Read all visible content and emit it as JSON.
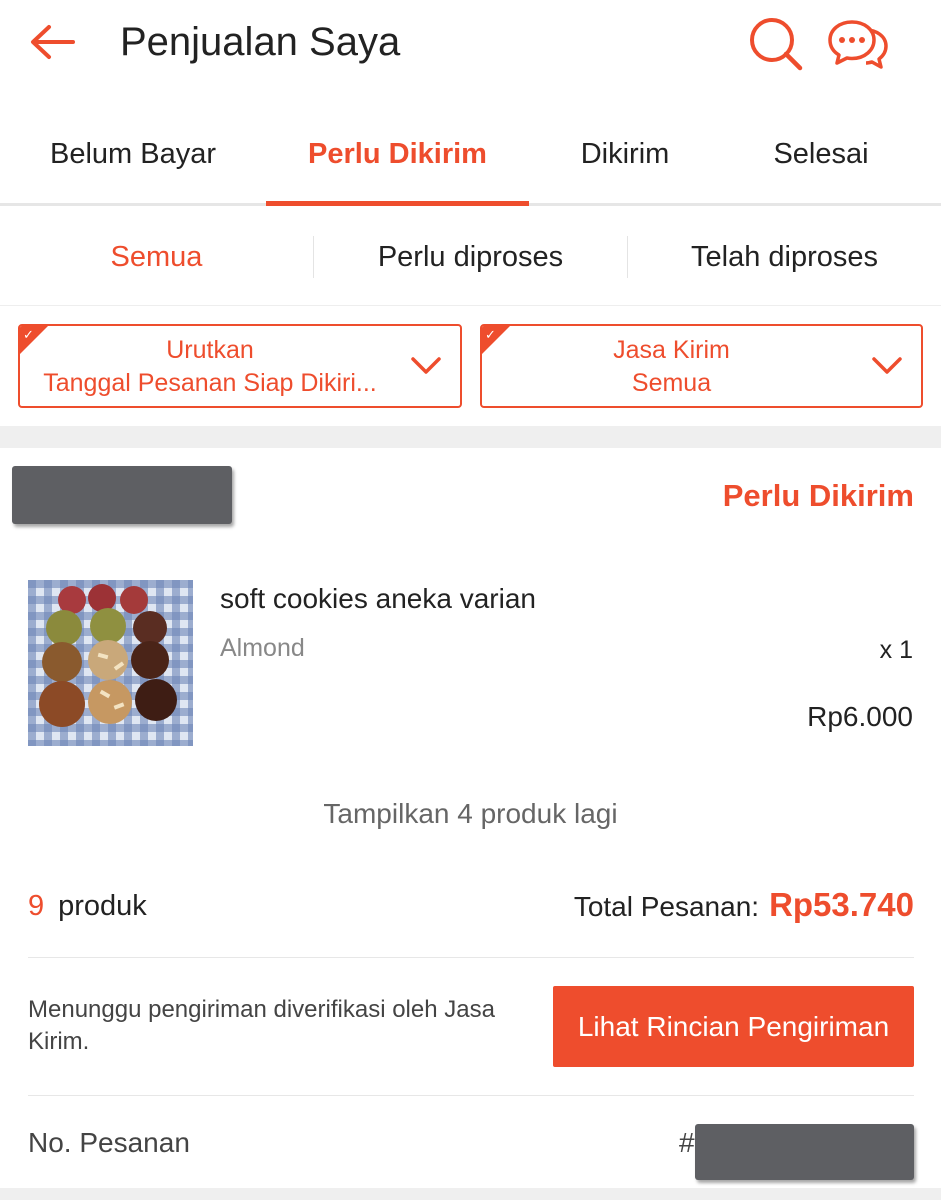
{
  "header": {
    "title": "Penjualan Saya",
    "back_icon": "arrow-left-icon",
    "search_icon": "search-icon",
    "chat_icon": "chat-bubbles-icon"
  },
  "tabs": [
    {
      "label": "Belum Bayar",
      "active": false
    },
    {
      "label": "Perlu Dikirim",
      "active": true
    },
    {
      "label": "Dikirim",
      "active": false
    },
    {
      "label": "Selesai",
      "active": false
    }
  ],
  "subtabs": [
    {
      "label": "Semua",
      "active": true
    },
    {
      "label": "Perlu diproses",
      "active": false
    },
    {
      "label": "Telah diproses",
      "active": false
    }
  ],
  "filters": {
    "sort": {
      "line1": "Urutkan",
      "line2": "Tanggal Pesanan Siap Dikiri..."
    },
    "courier": {
      "line1": "Jasa Kirim",
      "line2": "Semua"
    }
  },
  "order": {
    "status": "Perlu Dikirim",
    "product": {
      "name": "soft cookies aneka varian",
      "variant": "Almond",
      "qty": "x 1",
      "price": "Rp6.000"
    },
    "show_more": "Tampilkan 4 produk lagi",
    "count": "9",
    "count_label": "produk",
    "total_label": "Total Pesanan:",
    "total_value": "Rp53.740",
    "waiting_text": "Menunggu pengiriman diverifikasi oleh Jasa Kirim.",
    "action_button": "Lihat Rincian Pengiriman",
    "order_no_label": "No. Pesanan",
    "order_no_prefix": "#"
  },
  "colors": {
    "accent": "#ee4d2d",
    "redaction": "#5e5f63",
    "divider": "#efefef"
  }
}
